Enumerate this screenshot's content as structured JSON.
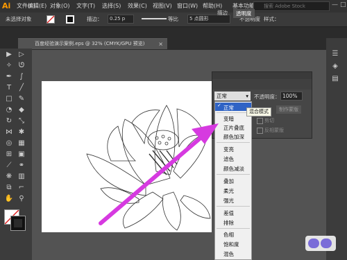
{
  "app": {
    "logo_text": "Ai"
  },
  "menubar": {
    "items": [
      "文件(F)",
      "编辑(E)",
      "对象(O)",
      "文字(T)",
      "选择(S)",
      "效果(C)",
      "视图(V)",
      "窗口(W)",
      "帮助(H)"
    ],
    "workspace": "基本功能",
    "search_placeholder": "搜索 Adobe Stock",
    "window_controls": [
      "—",
      "□",
      "×"
    ]
  },
  "control_bar": {
    "no_selection": "未选择对象",
    "stroke_label": "描边：",
    "stroke_value": "0.25 p",
    "profile_label": "等比",
    "brush_label": "5 点圆形",
    "opacity_label": "不透明度",
    "style_label": "样式："
  },
  "document_tab": {
    "title": "百度经验演示案例.eps @ 32% (CMYK/GPU 预览)",
    "close": "×"
  },
  "transparency_panel": {
    "tabs": [
      "描边",
      "透明度"
    ],
    "active_tab": "透明度",
    "blend_mode": "正常",
    "opacity_label": "不透明度：",
    "opacity_value": "100%",
    "make_mask_button": "制作蒙版",
    "clip_label": "剪切",
    "invert_mask_label": "反相蒙版"
  },
  "blend_menu": {
    "items": [
      "正常",
      "变暗",
      "正片叠底",
      "颜色加深",
      "变亮",
      "滤色",
      "颜色减淡",
      "叠加",
      "柔光",
      "强光",
      "差值",
      "排除",
      "色相",
      "饱和度",
      "混色"
    ],
    "selected": "正常"
  },
  "tooltip": {
    "text": "混合模式"
  },
  "colors": {
    "accent_highlight": "#2f63c5",
    "annotation_arrow": "#d63ae0",
    "ai_logo": "#ff9a00"
  },
  "icons": {
    "toolbar": [
      "selection-icon",
      "direct-selection-icon",
      "magic-wand-icon",
      "lasso-icon",
      "pen-icon",
      "curvature-icon",
      "type-icon",
      "line-icon",
      "rectangle-icon",
      "brush-icon",
      "shaper-icon",
      "eraser-icon",
      "rotate-icon",
      "scale-icon",
      "width-icon",
      "puppet-warp-icon",
      "shape-builder-icon",
      "perspective-icon",
      "mesh-icon",
      "gradient-icon",
      "eyedropper-icon",
      "blend-icon",
      "symbol-sprayer-icon",
      "graph-icon",
      "artboard-icon",
      "slice-icon",
      "hand-icon",
      "zoom-icon"
    ],
    "right_panel": [
      "properties-icon",
      "layers-icon",
      "libraries-icon"
    ]
  }
}
